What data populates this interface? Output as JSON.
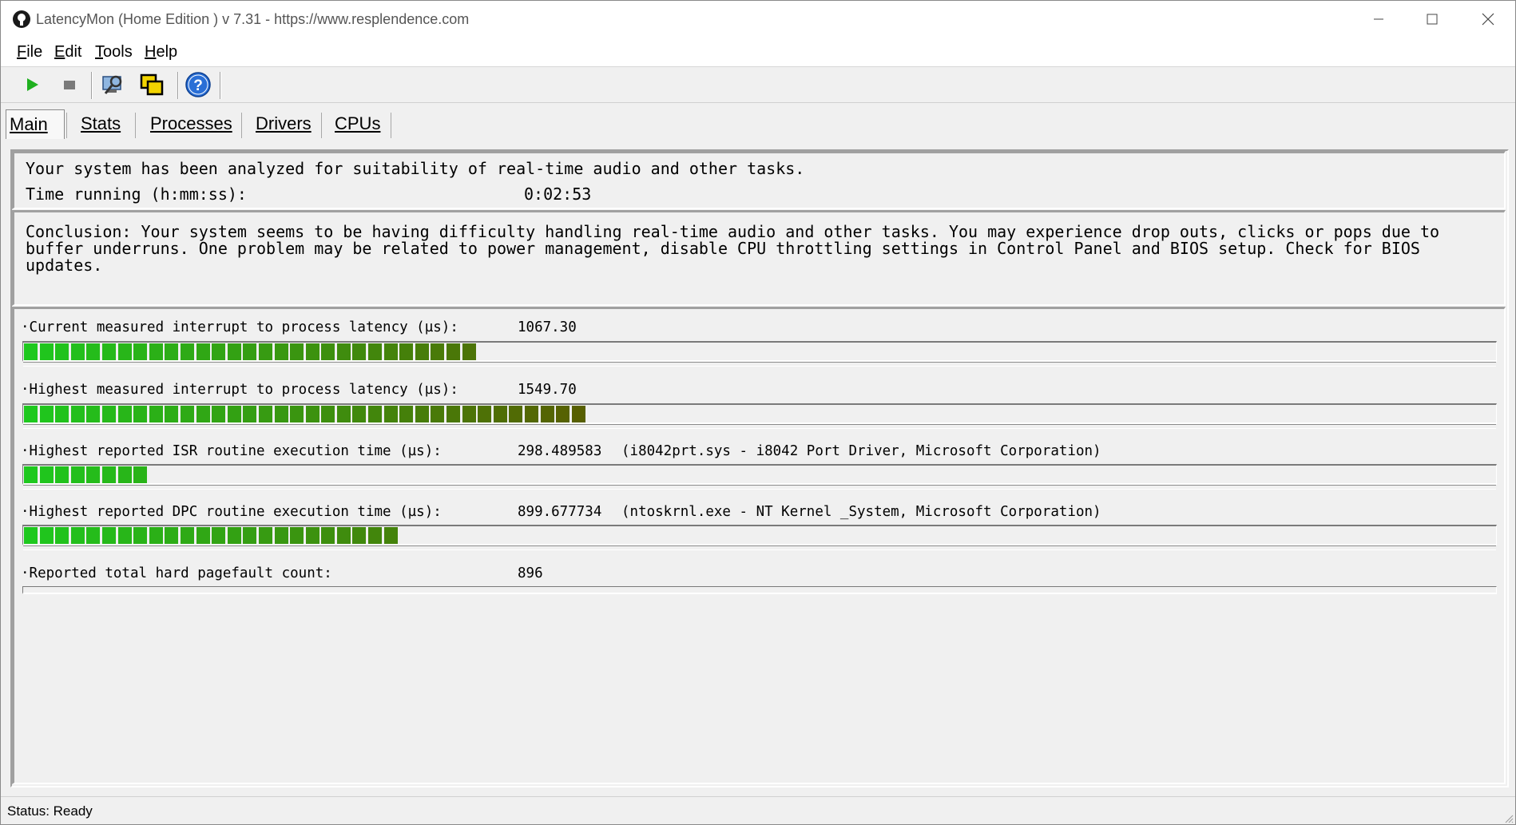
{
  "window": {
    "title": "LatencyMon  (Home Edition )  v 7.31 - https://www.resplendence.com",
    "controls": [
      "minimize-icon",
      "maximize-icon",
      "close-icon"
    ]
  },
  "menu": {
    "items": [
      {
        "label": "File",
        "accel": "F",
        "rest": "ile"
      },
      {
        "label": "Edit",
        "accel": "E",
        "rest": "dit"
      },
      {
        "label": "Tools",
        "accel": "T",
        "rest": "ools"
      },
      {
        "label": "Help",
        "accel": "H",
        "rest": "elp"
      }
    ]
  },
  "toolbar": {
    "buttons": [
      "play-icon",
      "stop-icon",
      "analyze-icon",
      "windows-icon",
      "help-icon"
    ],
    "colors": {
      "play": "#1fb01f",
      "stop": "#7a7a7a",
      "help": "#2a6fd6",
      "windows": "#f2d400"
    }
  },
  "tabs": [
    {
      "label": "Main",
      "active": true
    },
    {
      "label": "Stats",
      "active": false
    },
    {
      "label": "Processes",
      "active": false
    },
    {
      "label": "Drivers",
      "active": false
    },
    {
      "label": "CPUs",
      "active": false
    }
  ],
  "summary": {
    "line1": "Your system has been analyzed for suitability of real-time audio and other tasks.",
    "time_label": "Time running (h:mm:ss):",
    "time_value": "0:02:53"
  },
  "conclusion": "Conclusion: Your system seems to be having difficulty handling real-time audio and other tasks. You may experience drop outs, clicks or pops due to buffer underruns. One problem may be related to power management, disable CPU throttling settings in Control Panel and BIOS setup. Check for BIOS updates.",
  "metrics": [
    {
      "label": "·Current measured interrupt to process latency (µs):",
      "value": "1067.30",
      "extra": "",
      "bar_segments": 29,
      "bar_fraction": 0.306
    },
    {
      "label": "·Highest measured interrupt to process latency (µs):",
      "value": "1549.70",
      "extra": "",
      "bar_segments": 36,
      "bar_fraction": 0.38
    },
    {
      "label": "·Highest reported ISR routine execution time (µs):",
      "value": "298.489583",
      "extra": "(i8042prt.sys - i8042 Port Driver, Microsoft Corporation)",
      "bar_segments": 8,
      "bar_fraction": 0.087
    },
    {
      "label": "·Highest reported DPC routine execution time (µs):",
      "value": "899.677734",
      "extra": "(ntoskrnl.exe - NT Kernel _System, Microsoft Corporation)",
      "bar_segments": 24,
      "bar_fraction": 0.253
    },
    {
      "label": "·Reported total hard pagefault count:",
      "value": "896",
      "extra": "",
      "bar_segments": 0,
      "bar_fraction": 0
    }
  ],
  "bar_colors": {
    "bright": "#1ec81e",
    "dark": "#5a5a00"
  },
  "status": {
    "text": "Status: Ready"
  }
}
